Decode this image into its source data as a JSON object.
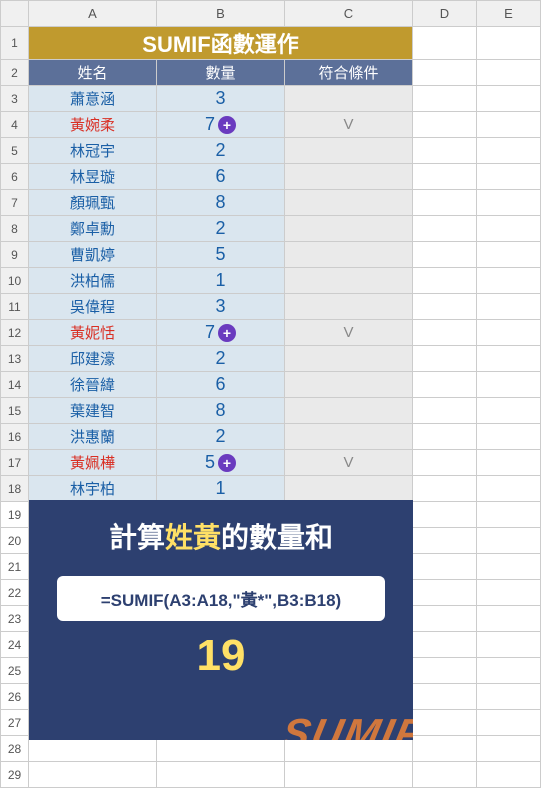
{
  "columns": [
    "A",
    "B",
    "C",
    "D",
    "E"
  ],
  "title": "SUMIF函數運作",
  "headers": {
    "name": "姓名",
    "qty": "數量",
    "match": "符合條件"
  },
  "rows": [
    {
      "r": 3,
      "name": "蕭意涵",
      "qty": "3",
      "mark": "",
      "red": false,
      "plus": false
    },
    {
      "r": 4,
      "name": "黃婉柔",
      "qty": "7",
      "mark": "V",
      "red": true,
      "plus": true
    },
    {
      "r": 5,
      "name": "林冠宇",
      "qty": "2",
      "mark": "",
      "red": false,
      "plus": false
    },
    {
      "r": 6,
      "name": "林昱璇",
      "qty": "6",
      "mark": "",
      "red": false,
      "plus": false
    },
    {
      "r": 7,
      "name": "顏珮甄",
      "qty": "8",
      "mark": "",
      "red": false,
      "plus": false
    },
    {
      "r": 8,
      "name": "鄭卓勳",
      "qty": "2",
      "mark": "",
      "red": false,
      "plus": false
    },
    {
      "r": 9,
      "name": "曹凱婷",
      "qty": "5",
      "mark": "",
      "red": false,
      "plus": false
    },
    {
      "r": 10,
      "name": "洪柏儒",
      "qty": "1",
      "mark": "",
      "red": false,
      "plus": false
    },
    {
      "r": 11,
      "name": "吳偉程",
      "qty": "3",
      "mark": "",
      "red": false,
      "plus": false
    },
    {
      "r": 12,
      "name": "黃妮恬",
      "qty": "7",
      "mark": "V",
      "red": true,
      "plus": true
    },
    {
      "r": 13,
      "name": "邱建濠",
      "qty": "2",
      "mark": "",
      "red": false,
      "plus": false
    },
    {
      "r": 14,
      "name": "徐晉緯",
      "qty": "6",
      "mark": "",
      "red": false,
      "plus": false
    },
    {
      "r": 15,
      "name": "葉建智",
      "qty": "8",
      "mark": "",
      "red": false,
      "plus": false
    },
    {
      "r": 16,
      "name": "洪惠蘭",
      "qty": "2",
      "mark": "",
      "red": false,
      "plus": false
    },
    {
      "r": 17,
      "name": "黃姵樺",
      "qty": "5",
      "mark": "V",
      "red": true,
      "plus": true
    },
    {
      "r": 18,
      "name": "林宇柏",
      "qty": "1",
      "mark": "",
      "red": false,
      "plus": false
    }
  ],
  "summary": {
    "label_prefix": "計算",
    "label_highlight": "姓黃",
    "label_suffix": "的數量和",
    "formula": "=SUMIF(A3:A18,\"黃*\",B3:B18)",
    "result": "19",
    "watermark": "SUMIF"
  },
  "extra_rows": [
    19,
    20,
    21,
    22,
    23,
    24,
    25,
    26,
    27,
    28,
    29
  ]
}
